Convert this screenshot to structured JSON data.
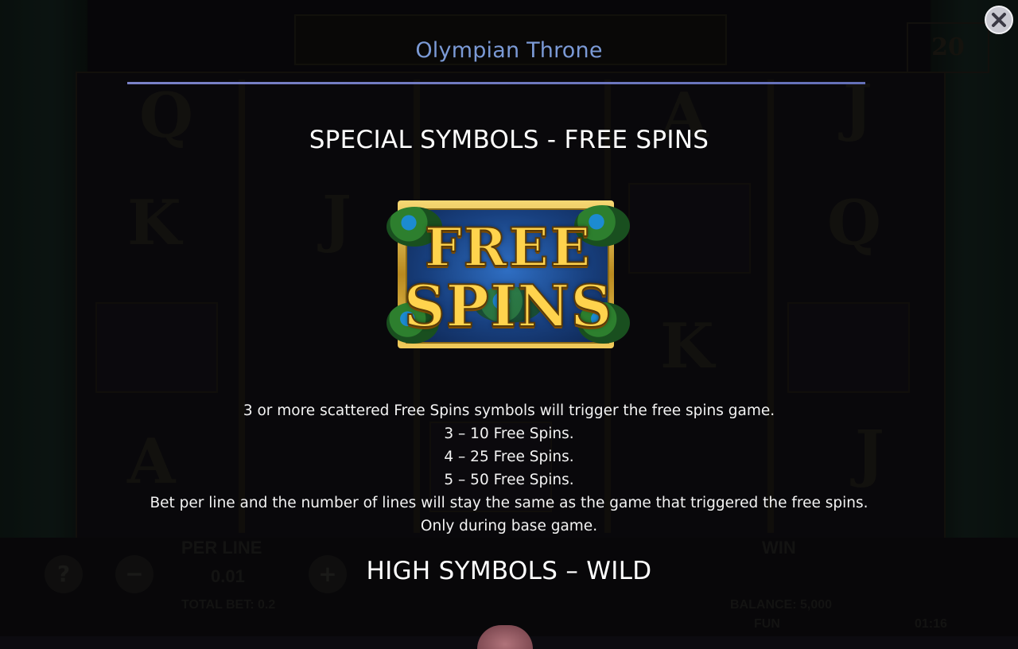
{
  "game": {
    "title": "Olympian Throne"
  },
  "background": {
    "lines_value": "20",
    "reel_letters": [
      "Q",
      "K",
      "J",
      "A",
      "J",
      "Q",
      "K",
      "A",
      "J"
    ],
    "per_line_label": "PER LINE",
    "per_line_value": "0.01",
    "win_label": "WIN",
    "total_bet": "TOTAL BET: 0.2",
    "balance": "BALANCE: 5,000",
    "mode": "FUN",
    "clock": "01:16",
    "help_symbol": "?",
    "minus_symbol": "−",
    "plus_symbol": "+"
  },
  "free_spins": {
    "heading": "SPECIAL SYMBOLS - FREE SPINS",
    "symbol_line1": "FREE",
    "symbol_line2": "SPINS",
    "lines": [
      "3 or more scattered Free Spins symbols will trigger the free spins game.",
      "3 – 10 Free Spins.",
      "4 – 25 Free Spins.",
      "5 – 50 Free Spins.",
      "Bet per line and the number of lines will stay the same as the game that triggered the free spins.",
      "Only during base game."
    ]
  },
  "wild": {
    "heading": "HIGH SYMBOLS – WILD"
  },
  "icons": {
    "close": "close-icon"
  },
  "colors": {
    "title": "#7b9ad6",
    "rule": "#6c76c0",
    "text": "#ffffff",
    "symbol_gold": "#ffd34d"
  }
}
